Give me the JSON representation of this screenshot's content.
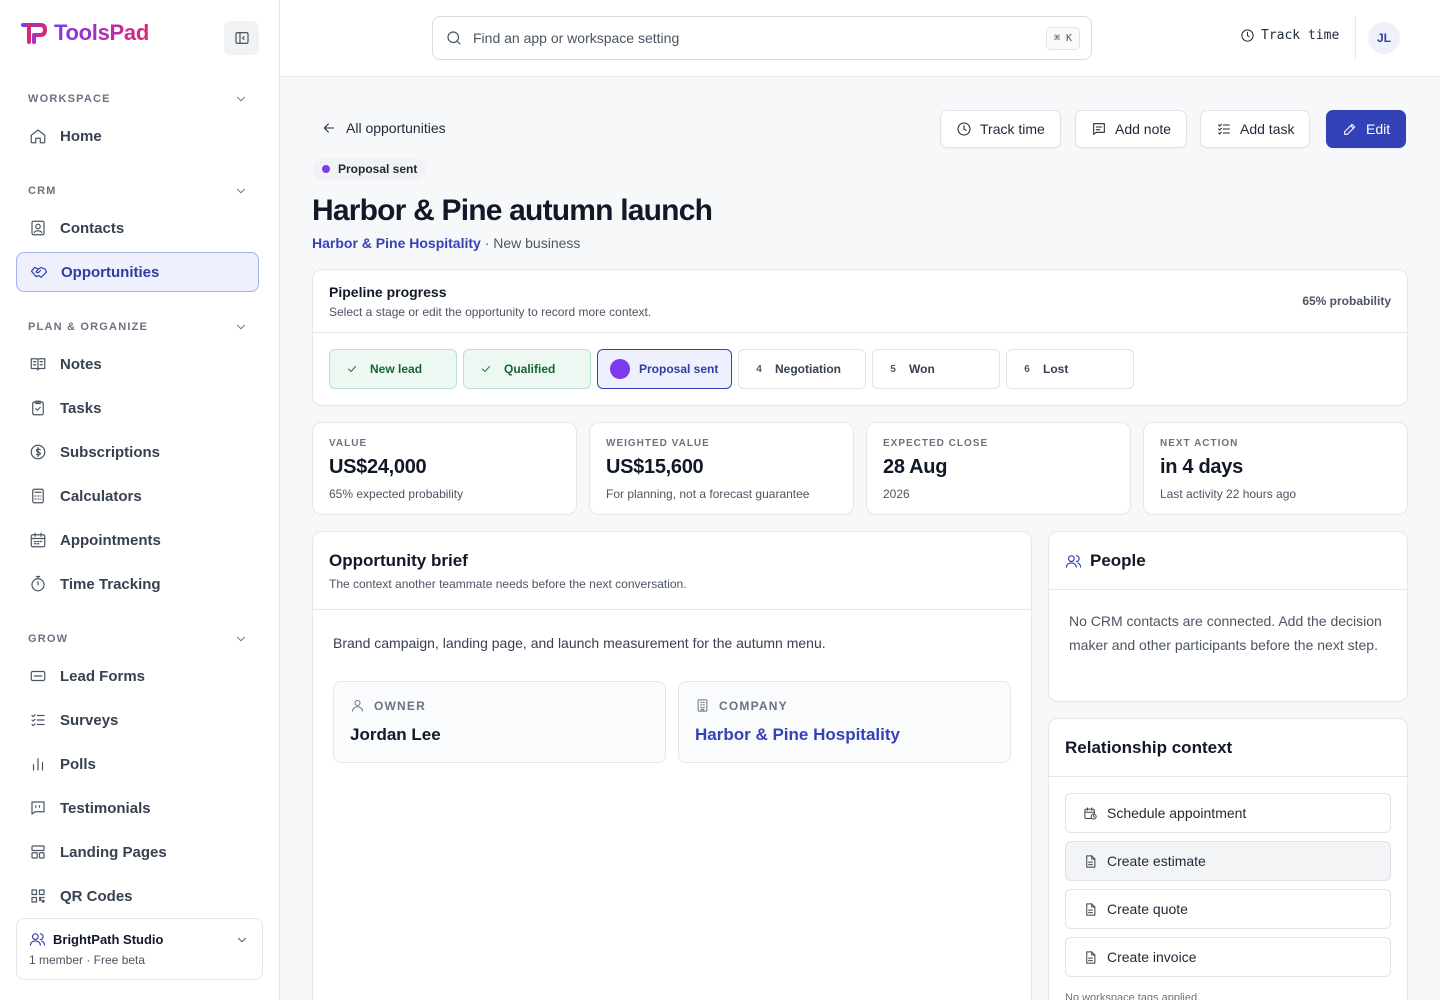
{
  "brand": {
    "name": "ToolsPad"
  },
  "sidebar": {
    "sections": [
      {
        "label": "WORKSPACE"
      },
      {
        "label": "CRM"
      },
      {
        "label": "PLAN & ORGANIZE"
      },
      {
        "label": "GROW"
      }
    ],
    "items": [
      {
        "label": "Home",
        "icon": "home-icon"
      },
      {
        "label": "Contacts",
        "icon": "contacts-icon"
      },
      {
        "label": "Opportunities",
        "icon": "handshake-icon",
        "active": true
      },
      {
        "label": "Notes",
        "icon": "notes-icon"
      },
      {
        "label": "Tasks",
        "icon": "tasks-icon"
      },
      {
        "label": "Subscriptions",
        "icon": "dollar-icon"
      },
      {
        "label": "Calculators",
        "icon": "calculator-icon"
      },
      {
        "label": "Appointments",
        "icon": "calendar-icon"
      },
      {
        "label": "Time Tracking",
        "icon": "stopwatch-icon"
      },
      {
        "label": "Lead Forms",
        "icon": "form-icon"
      },
      {
        "label": "Surveys",
        "icon": "checklist-icon"
      },
      {
        "label": "Polls",
        "icon": "bar-chart-icon"
      },
      {
        "label": "Testimonials",
        "icon": "quote-icon"
      },
      {
        "label": "Landing Pages",
        "icon": "layout-icon"
      },
      {
        "label": "QR Codes",
        "icon": "qr-icon"
      }
    ],
    "workspace": {
      "name": "BrightPath Studio",
      "meta": "1 member · Free beta"
    }
  },
  "topbar": {
    "search_placeholder": "Find an app or workspace setting",
    "shortcut": "⌘ K",
    "track_time": "Track time",
    "avatar_initials": "JL"
  },
  "header": {
    "back_label": "All opportunities",
    "actions": {
      "track_time": "Track time",
      "add_note": "Add note",
      "add_task": "Add task",
      "edit": "Edit"
    },
    "status": "Proposal sent",
    "title": "Harbor & Pine autumn launch",
    "company_link": "Harbor & Pine Hospitality",
    "subtitle_rest": " · New business"
  },
  "pipeline": {
    "title": "Pipeline progress",
    "subtitle": "Select a stage or edit the opportunity to record more context.",
    "probability": "65% probability",
    "stages": [
      {
        "label": "New lead",
        "state": "done"
      },
      {
        "label": "Qualified",
        "state": "done"
      },
      {
        "label": "Proposal sent",
        "state": "current"
      },
      {
        "num": "4",
        "label": "Negotiation",
        "state": "todo"
      },
      {
        "num": "5",
        "label": "Won",
        "state": "todo"
      },
      {
        "num": "6",
        "label": "Lost",
        "state": "todo"
      }
    ]
  },
  "stats": [
    {
      "label": "VALUE",
      "value": "US$24,000",
      "note": "65% expected probability"
    },
    {
      "label": "WEIGHTED VALUE",
      "value": "US$15,600",
      "note": "For planning, not a forecast guarantee"
    },
    {
      "label": "EXPECTED CLOSE",
      "value": "28 Aug",
      "note": "2026"
    },
    {
      "label": "NEXT ACTION",
      "value": "in 4 days",
      "note": "Last activity 22 hours ago"
    }
  ],
  "brief": {
    "title": "Opportunity brief",
    "subtitle": "The context another teammate needs before the next conversation.",
    "text": "Brand campaign, landing page, and launch measurement for the autumn menu.",
    "owner_label": "OWNER",
    "owner": "Jordan Lee",
    "company_label": "COMPANY",
    "company": "Harbor & Pine Hospitality"
  },
  "people": {
    "title": "People",
    "text": "No CRM contacts are connected. Add the decision maker and other participants before the next step."
  },
  "relationship": {
    "title": "Relationship context",
    "actions": [
      {
        "label": "Schedule appointment",
        "icon": "calendar-clock-icon"
      },
      {
        "label": "Create estimate",
        "icon": "document-icon"
      },
      {
        "label": "Create quote",
        "icon": "document-icon"
      },
      {
        "label": "Create invoice",
        "icon": "document-icon"
      }
    ],
    "tags_note": "No workspace tags applied"
  }
}
